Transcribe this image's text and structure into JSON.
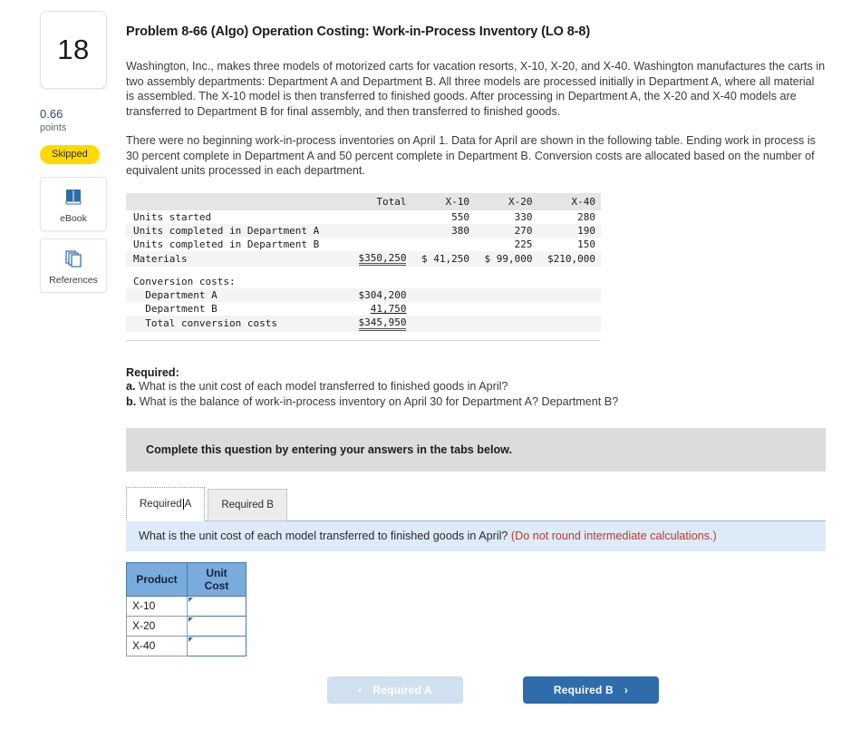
{
  "sidebar": {
    "question_number": "18",
    "points_value": "0.66",
    "points_label": "points",
    "status_badge": "Skipped",
    "tools": [
      {
        "label": "eBook",
        "icon": "book-icon"
      },
      {
        "label": "References",
        "icon": "pages-icon"
      }
    ]
  },
  "problem": {
    "title": "Problem 8-66 (Algo) Operation Costing: Work-in-Process Inventory (LO 8-8)",
    "paragraph1": "Washington, Inc., makes three models of motorized carts for vacation resorts, X-10, X-20, and X-40. Washington manufactures the carts in two assembly departments: Department A and Department B. All three models are processed initially in Department A, where all material is assembled. The X-10 model is then transferred to finished goods. After processing in Department A, the X-20 and X-40 models are transferred to Department B for final assembly, and then transferred to finished goods.",
    "paragraph2": "There were no beginning work-in-process inventories on April 1. Data for April are shown in the following table. Ending work in process is 30 percent complete in Department A and 50 percent complete in Department B. Conversion costs are allocated based on the number of equivalent units processed in each department."
  },
  "data_table": {
    "headers": [
      "",
      "Total",
      "X-10",
      "X-20",
      "X-40"
    ],
    "rows": [
      {
        "label": "Units started",
        "total": "",
        "x10": "550",
        "x20": "330",
        "x40": "280"
      },
      {
        "label": "Units completed in Department A",
        "total": "",
        "x10": "380",
        "x20": "270",
        "x40": "190"
      },
      {
        "label": "Units completed in Department B",
        "total": "",
        "x10": "",
        "x20": "225",
        "x40": "150"
      },
      {
        "label": "Materials",
        "total": "$350,250",
        "x10": "$ 41,250",
        "x20": "$ 99,000",
        "x40": "$210,000"
      }
    ],
    "conversion_header": "Conversion costs:",
    "conversion_rows": [
      {
        "label": "  Department A",
        "total": "$304,200"
      },
      {
        "label": "  Department B",
        "total": "41,750"
      },
      {
        "label": "  Total conversion costs",
        "total": "$345,950"
      }
    ]
  },
  "required": {
    "heading": "Required:",
    "item_a_marker": "a.",
    "item_a": "What is the unit cost of each model transferred to finished goods in April?",
    "item_b_marker": "b.",
    "item_b": "What is the balance of work-in-process inventory on April 30 for Department A? Department B?"
  },
  "complete_bar": "Complete this question by entering your answers in the tabs below.",
  "tabs": [
    {
      "label_before_caret": "Required ",
      "label_after_caret": "A",
      "active": true
    },
    {
      "label": "Required B",
      "active": false
    }
  ],
  "prompt": {
    "question": "What is the unit cost of each model transferred to finished goods in April?",
    "note": "(Do not round intermediate calculations.)"
  },
  "answer_table": {
    "headers": [
      "Product",
      "Unit Cost"
    ],
    "rows": [
      {
        "product": "X-10",
        "unit_cost": ""
      },
      {
        "product": "X-20",
        "unit_cost": ""
      },
      {
        "product": "X-40",
        "unit_cost": ""
      }
    ]
  },
  "nav": {
    "prev_label": "Required A",
    "prev_chevron": "‹",
    "next_label": "Required B",
    "next_chevron": "›"
  },
  "colors": {
    "accent_blue": "#2e6cab",
    "badge_yellow": "#ffd900",
    "prompt_bg": "#ddeaf7",
    "note_red": "#c0392b"
  }
}
